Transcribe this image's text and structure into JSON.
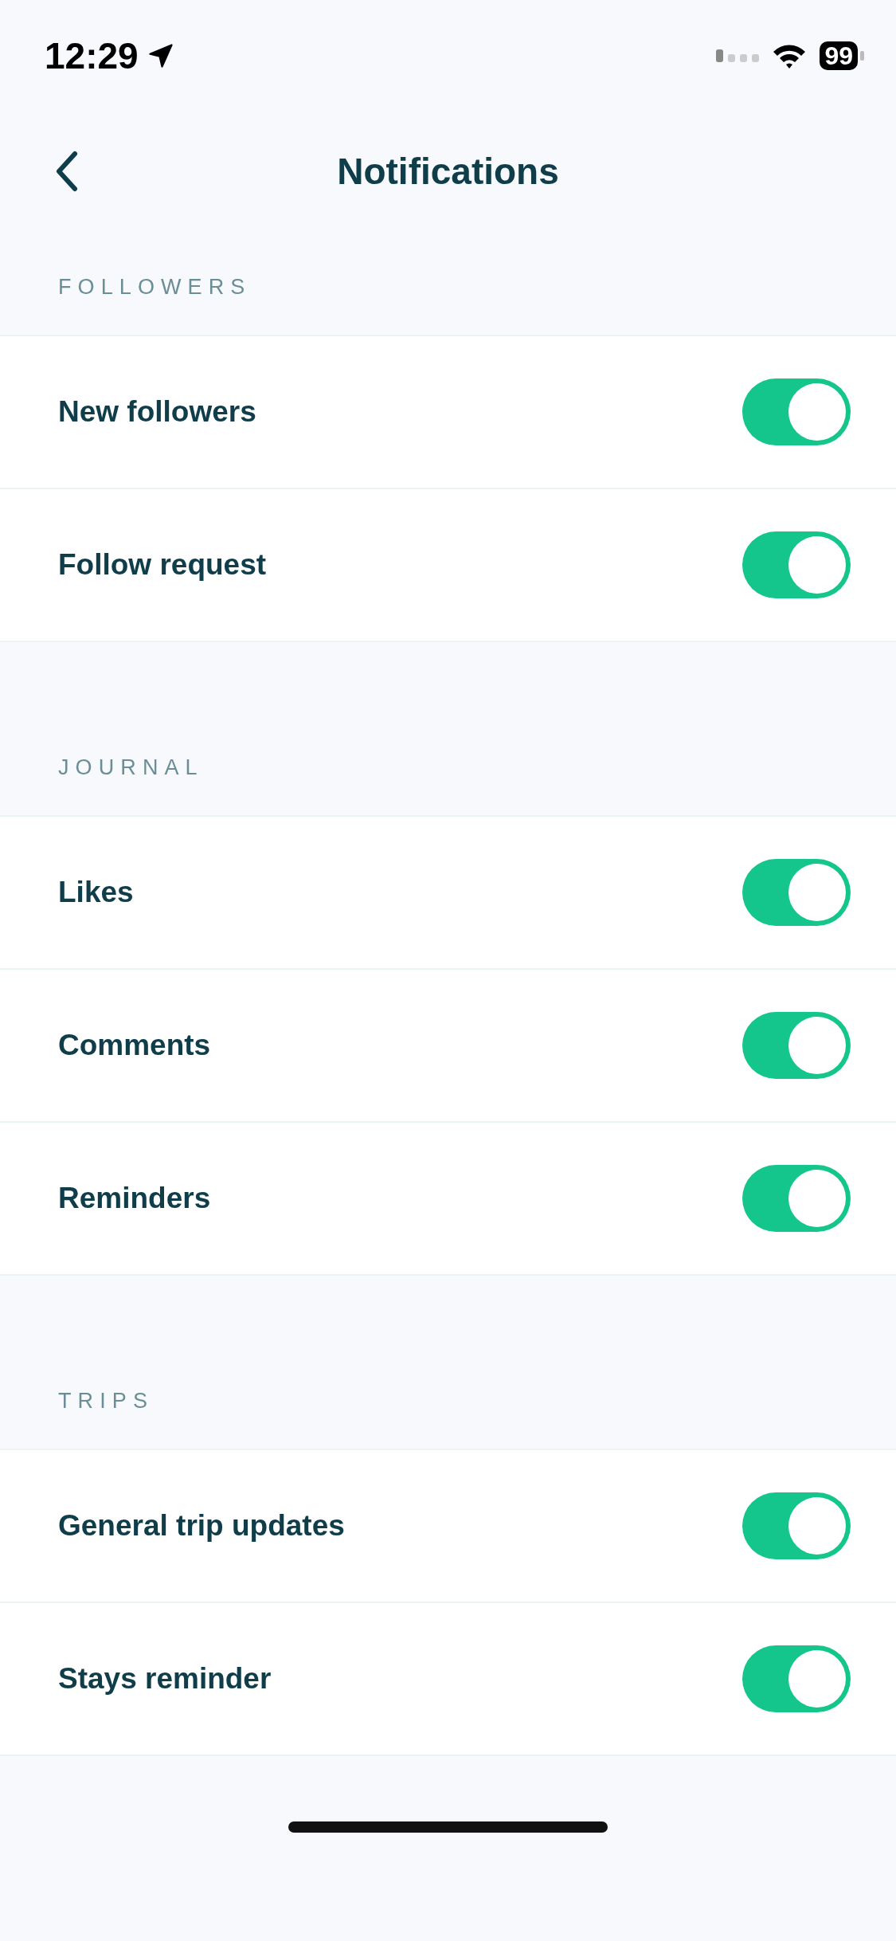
{
  "status_bar": {
    "time": "12:29",
    "battery": "99"
  },
  "header": {
    "title": "Notifications"
  },
  "sections": [
    {
      "title": "FOLLOWERS",
      "items": [
        {
          "label": "New followers",
          "on": true
        },
        {
          "label": "Follow request",
          "on": true
        }
      ]
    },
    {
      "title": "JOURNAL",
      "items": [
        {
          "label": "Likes",
          "on": true
        },
        {
          "label": "Comments",
          "on": true
        },
        {
          "label": "Reminders",
          "on": true
        }
      ]
    },
    {
      "title": "TRIPS",
      "items": [
        {
          "label": "General trip updates",
          "on": true
        },
        {
          "label": "Stays reminder",
          "on": true
        }
      ]
    }
  ]
}
